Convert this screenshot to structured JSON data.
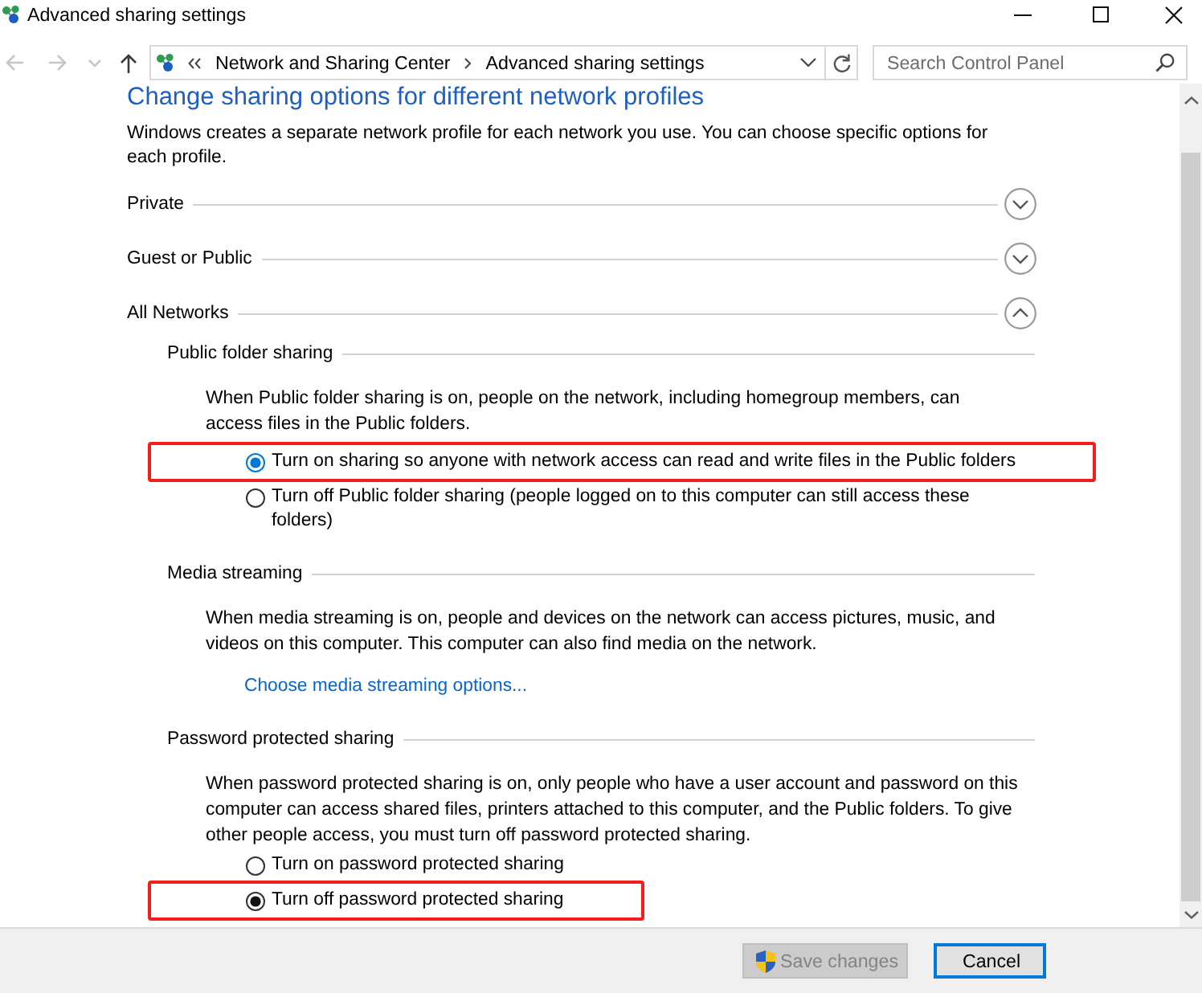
{
  "window": {
    "title": "Advanced sharing settings"
  },
  "nav_buttons": [
    {
      "kind": "back",
      "disabled": true
    },
    {
      "kind": "forward",
      "disabled": true
    },
    {
      "kind": "recent",
      "disabled": true
    },
    {
      "kind": "up",
      "disabled": false
    }
  ],
  "address_bar": {
    "breadcrumbs": [
      "Network and Sharing Center",
      "Advanced sharing settings"
    ]
  },
  "search": {
    "placeholder": "Search Control Panel"
  },
  "content": {
    "heading": "Change sharing options for different network profiles",
    "intro": "Windows creates a separate network profile for each network you use. You can choose specific options for each profile.",
    "profiles": [
      {
        "name": "Private",
        "expanded": false
      },
      {
        "name": "Guest or Public",
        "expanded": false
      },
      {
        "name": "All Networks",
        "expanded": true,
        "sections": [
          {
            "title": "Public folder sharing",
            "description": "When Public folder sharing is on, people on the network, including homegroup members, can access files in the Public folders.",
            "options": [
              {
                "label": "Turn on sharing so anyone with network access can read and write files in the Public folders",
                "selected": true,
                "focused": true,
                "highlighted": true
              },
              {
                "label": "Turn off Public folder sharing (people logged on to this computer can still access these folders)",
                "selected": false,
                "focused": false,
                "highlighted": false
              }
            ]
          },
          {
            "title": "Media streaming",
            "description": "When media streaming is on, people and devices on the network can access pictures, music, and videos on this computer. This computer can also find media on the network.",
            "link": "Choose media streaming options..."
          },
          {
            "title": "Password protected sharing",
            "description": "When password protected sharing is on, only people who have a user account and password on this computer can access shared files, printers attached to this computer, and the Public folders. To give other people access, you must turn off password protected sharing.",
            "options": [
              {
                "label": "Turn on password protected sharing",
                "selected": false,
                "focused": false,
                "highlighted": false
              },
              {
                "label": "Turn off password protected sharing",
                "selected": true,
                "focused": false,
                "highlighted": true
              }
            ]
          }
        ]
      }
    ]
  },
  "buttons": [
    {
      "label": "Save changes",
      "disabled": true,
      "elevated": true,
      "default": false
    },
    {
      "label": "Cancel",
      "disabled": false,
      "elevated": false,
      "default": true
    }
  ]
}
